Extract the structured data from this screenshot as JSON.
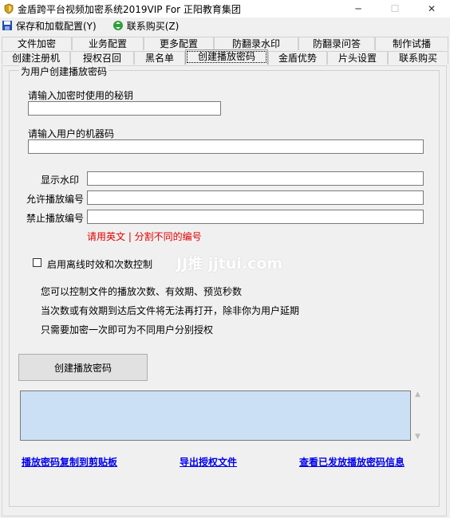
{
  "window": {
    "title": "金盾跨平台视频加密系统2019VIP For 正阳教育集团",
    "minimize": "─",
    "maximize": "☐",
    "close": "✕"
  },
  "menu": {
    "save_config": "保存和加载配置(Y)",
    "buy": "联系购买(Z)"
  },
  "tabs": {
    "row1": [
      "文件加密",
      "业务配置",
      "更多配置",
      "防翻录水印",
      "防翻录问答",
      "制作试播"
    ],
    "row2": [
      "创建注册机",
      "授权召回",
      "黑名单",
      "创建播放密码",
      "金盾优势",
      "片头设置",
      "联系购买"
    ],
    "active": "创建播放密码"
  },
  "group": {
    "legend": "为用户创建播放密码",
    "secret_label": "请输入加密时使用的秘钥",
    "secret_value": "",
    "machine_label": "请输入用户的机器码",
    "machine_value": "",
    "watermark_label": "显示水印",
    "watermark_value": "",
    "allow_label": "允许播放编号",
    "allow_value": "",
    "forbid_label": "禁止播放编号",
    "forbid_value": "",
    "separator_hint": "请用英文 | 分割不同的编号",
    "offline_checkbox_label": "启用离线时效和次数控制",
    "offline_checked": false,
    "info_lines": [
      "您可以控制文件的播放次数、有效期、预览秒数",
      "当次数或有效期到达后文件将无法再打开，除非你为用户延期",
      "只需要加密一次即可为不同用户分别授权"
    ],
    "create_button": "创建播放密码",
    "output_value": "",
    "link_copy": "播放密码复制到剪贴板",
    "link_export": "导出授权文件",
    "link_view": "查看已发放播放密码信息"
  },
  "overlay": {
    "watermark_text": "JJ推 jjtui.com"
  },
  "colors": {
    "output_bg": "#cce0f5",
    "hint_red": "#e00000",
    "link_blue": "#0000ee"
  }
}
